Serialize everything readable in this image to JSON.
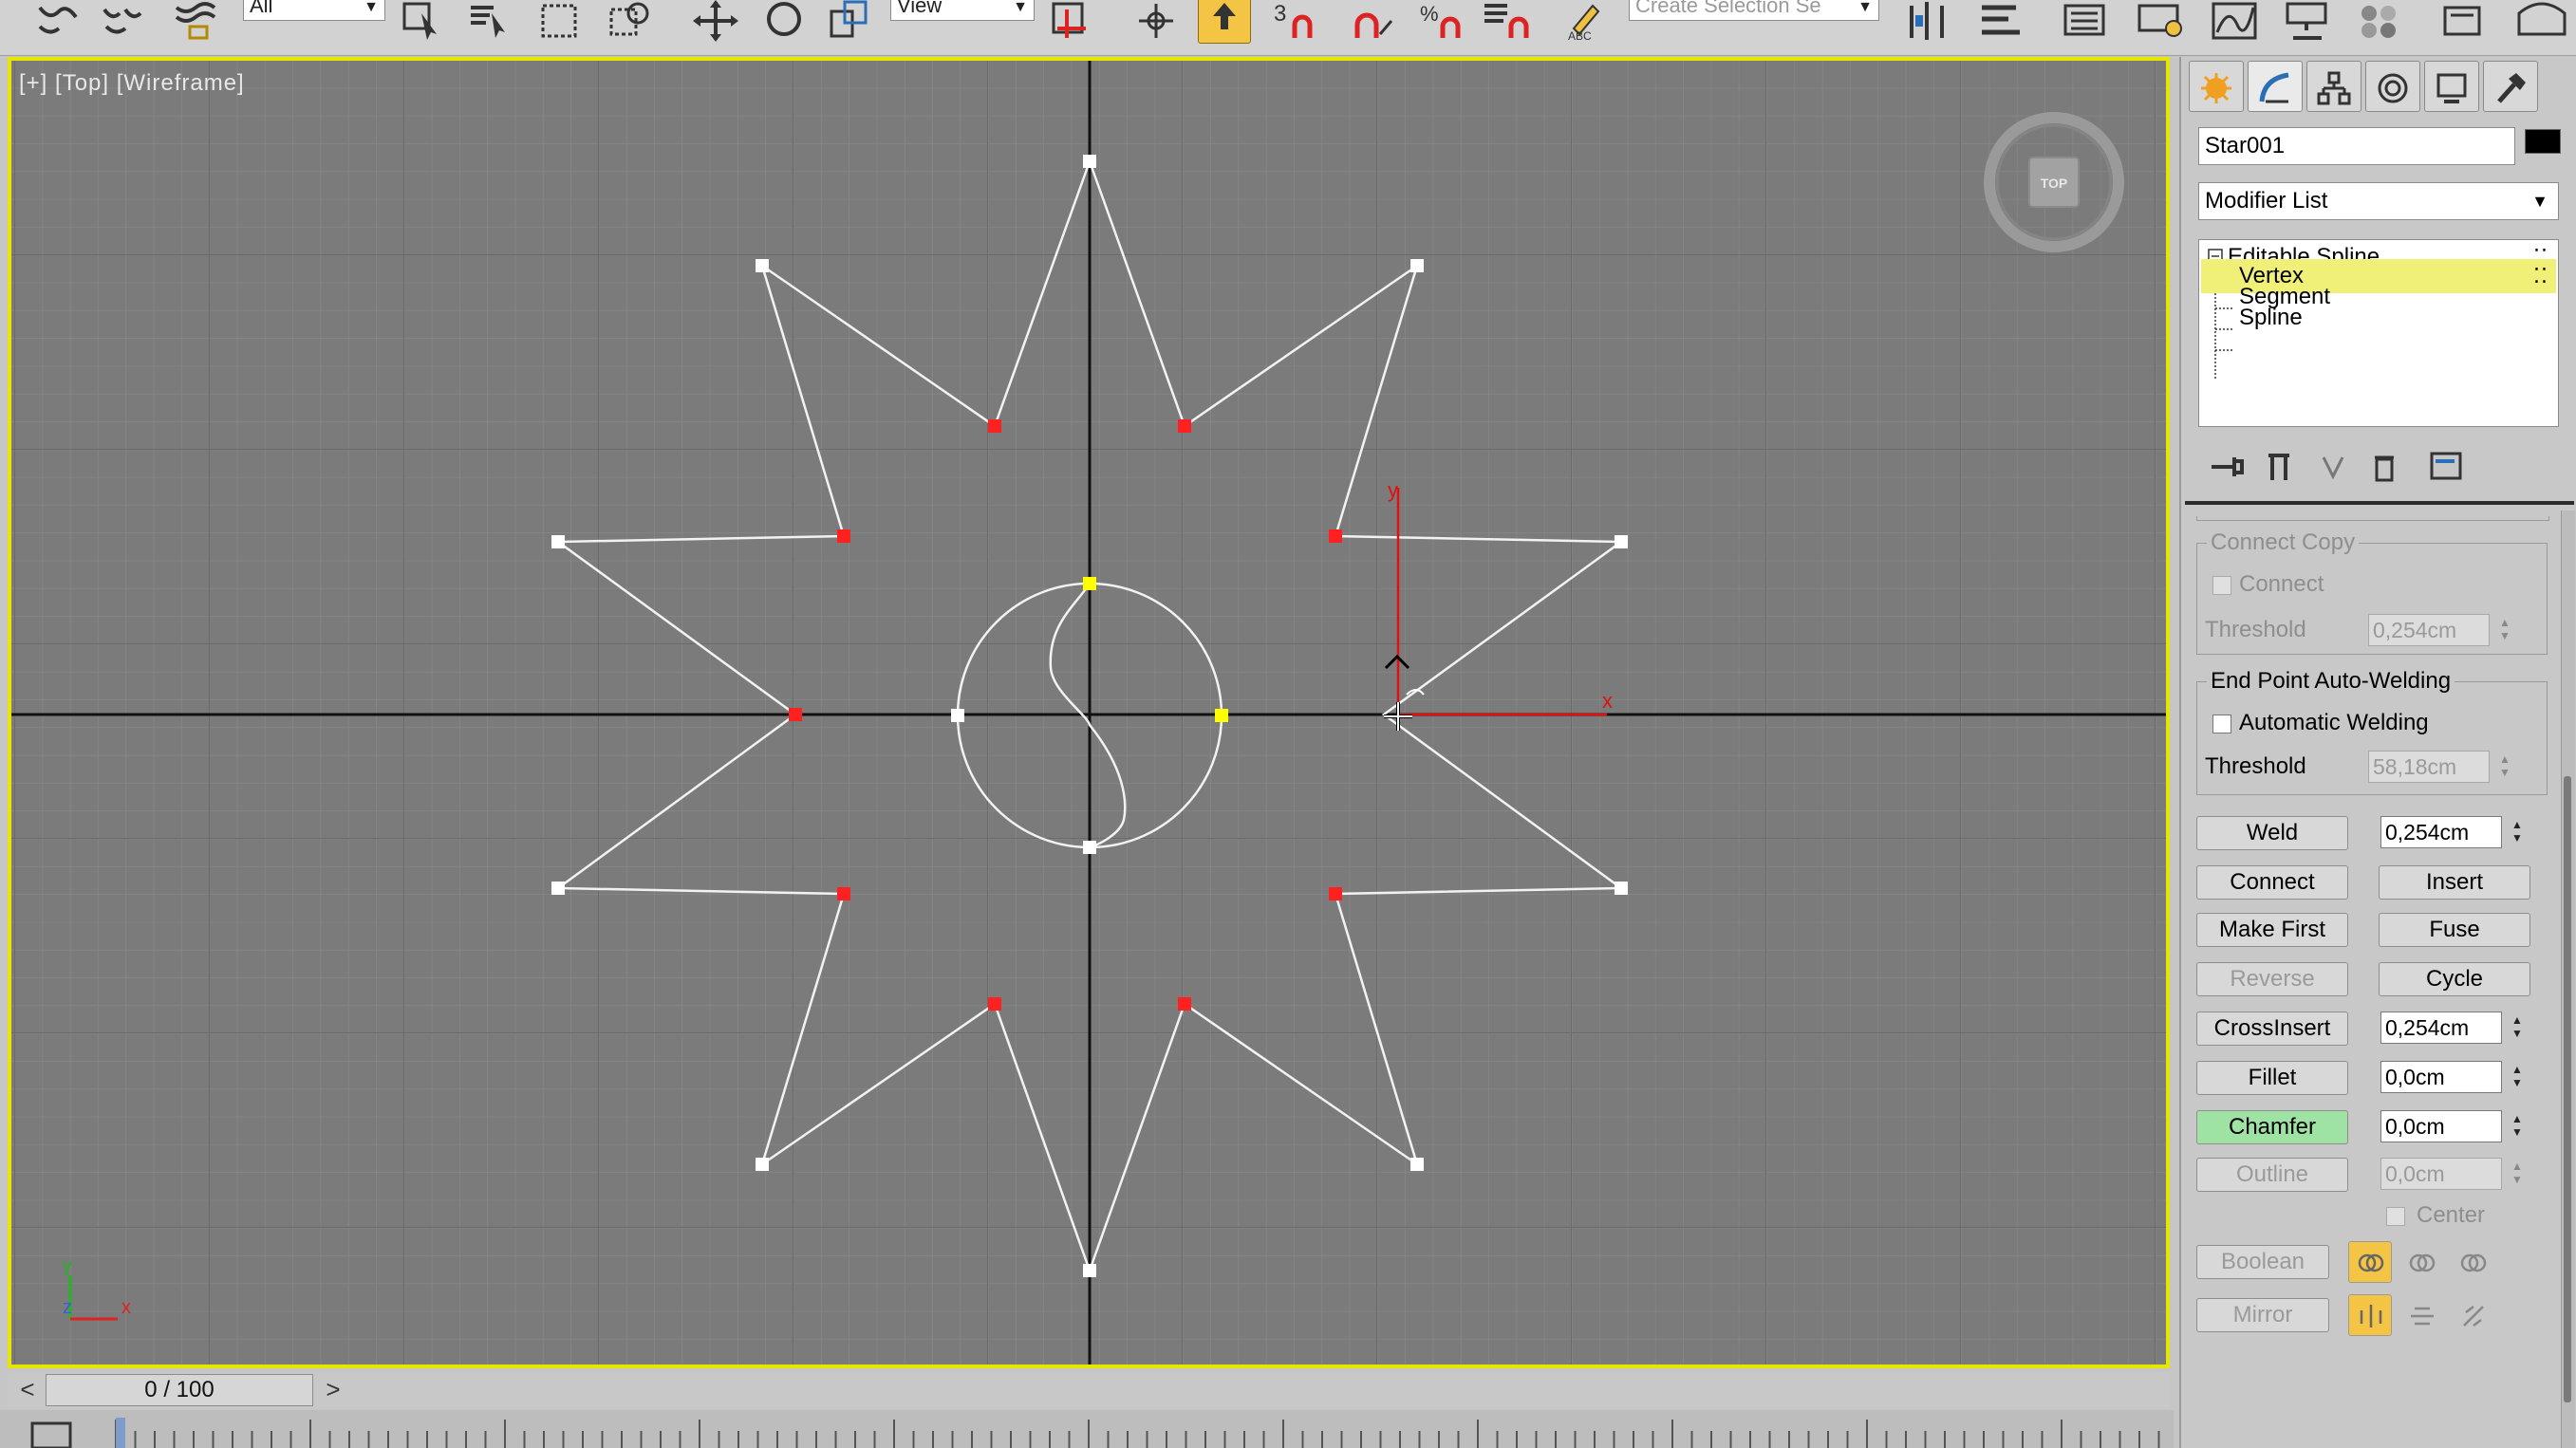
{
  "toolbar": {
    "selection_filter": "All",
    "reference_coord": "View",
    "selection_set_placeholder": "Create Selection Se",
    "icons": [
      "link-icon",
      "unlink-icon",
      "bind-space-warp-icon",
      "select-object-icon",
      "select-by-name-icon",
      "rectangular-selection-icon",
      "window-crossing-icon",
      "select-move-icon",
      "select-rotate-icon",
      "select-scale-icon",
      "select-manipulate-icon",
      "use-pivot-center-icon",
      "snap-toggle-icon",
      "angle-snap-icon",
      "percent-snap-icon",
      "spinner-snap-icon",
      "edit-named-selection-icon",
      "mirror-icon",
      "align-icon",
      "layer-explorer-icon",
      "toggle-ribbon-icon",
      "curve-editor-icon",
      "schematic-view-icon",
      "material-editor-icon",
      "render-setup-icon",
      "render-frame-icon",
      "render-icon"
    ]
  },
  "viewport": {
    "label": "[+] [Top] [Wireframe]",
    "border_color": "#e6e600",
    "background_color": "#7b7b7b",
    "viewcube_label": "TOP",
    "axis_x": "x",
    "axis_y": "y",
    "axis_z": "z",
    "gizmo_x": "x",
    "gizmo_y": "y"
  },
  "timeslider": {
    "prev": "<",
    "next": ">",
    "frame": "0 / 100"
  },
  "panel": {
    "tabs": [
      "create-tab",
      "modify-tab",
      "hierarchy-tab",
      "motion-tab",
      "display-tab",
      "utilities-tab"
    ],
    "object_name": "Star001",
    "object_color": "#000000",
    "modifier_list": "Modifier List",
    "stack": {
      "root": "Editable Spline",
      "items": [
        "Vertex",
        "Segment",
        "Spline"
      ],
      "selected": "Vertex"
    },
    "stack_tools": [
      "pin-stack-icon",
      "show-end-result-icon",
      "make-unique-icon",
      "remove-modifier-icon",
      "configure-modifier-sets-icon"
    ]
  },
  "rollout": {
    "connect_copy": {
      "title": "Connect Copy",
      "connect_label": "Connect",
      "threshold_label": "Threshold",
      "threshold_value": "0,254cm"
    },
    "auto_weld": {
      "title": "End Point Auto-Welding",
      "auto_label": "Automatic Welding",
      "threshold_label": "Threshold",
      "threshold_value": "58,18cm"
    },
    "weld_label": "Weld",
    "weld_value": "0,254cm",
    "connect_label": "Connect",
    "insert_label": "Insert",
    "make_first_label": "Make First",
    "fuse_label": "Fuse",
    "reverse_label": "Reverse",
    "cycle_label": "Cycle",
    "crossinsert_label": "CrossInsert",
    "crossinsert_value": "0,254cm",
    "fillet_label": "Fillet",
    "fillet_value": "0,0cm",
    "chamfer_label": "Chamfer",
    "chamfer_value": "0,0cm",
    "outline_label": "Outline",
    "outline_value": "0,0cm",
    "center_label": "Center",
    "boolean_label": "Boolean",
    "mirror_label": "Mirror"
  },
  "colors": {
    "selected_stack_item": "#f0f078",
    "active_button": "#9ee3a4",
    "selected_vertex": "#ff2020",
    "first_vertex": "#ffff00"
  }
}
